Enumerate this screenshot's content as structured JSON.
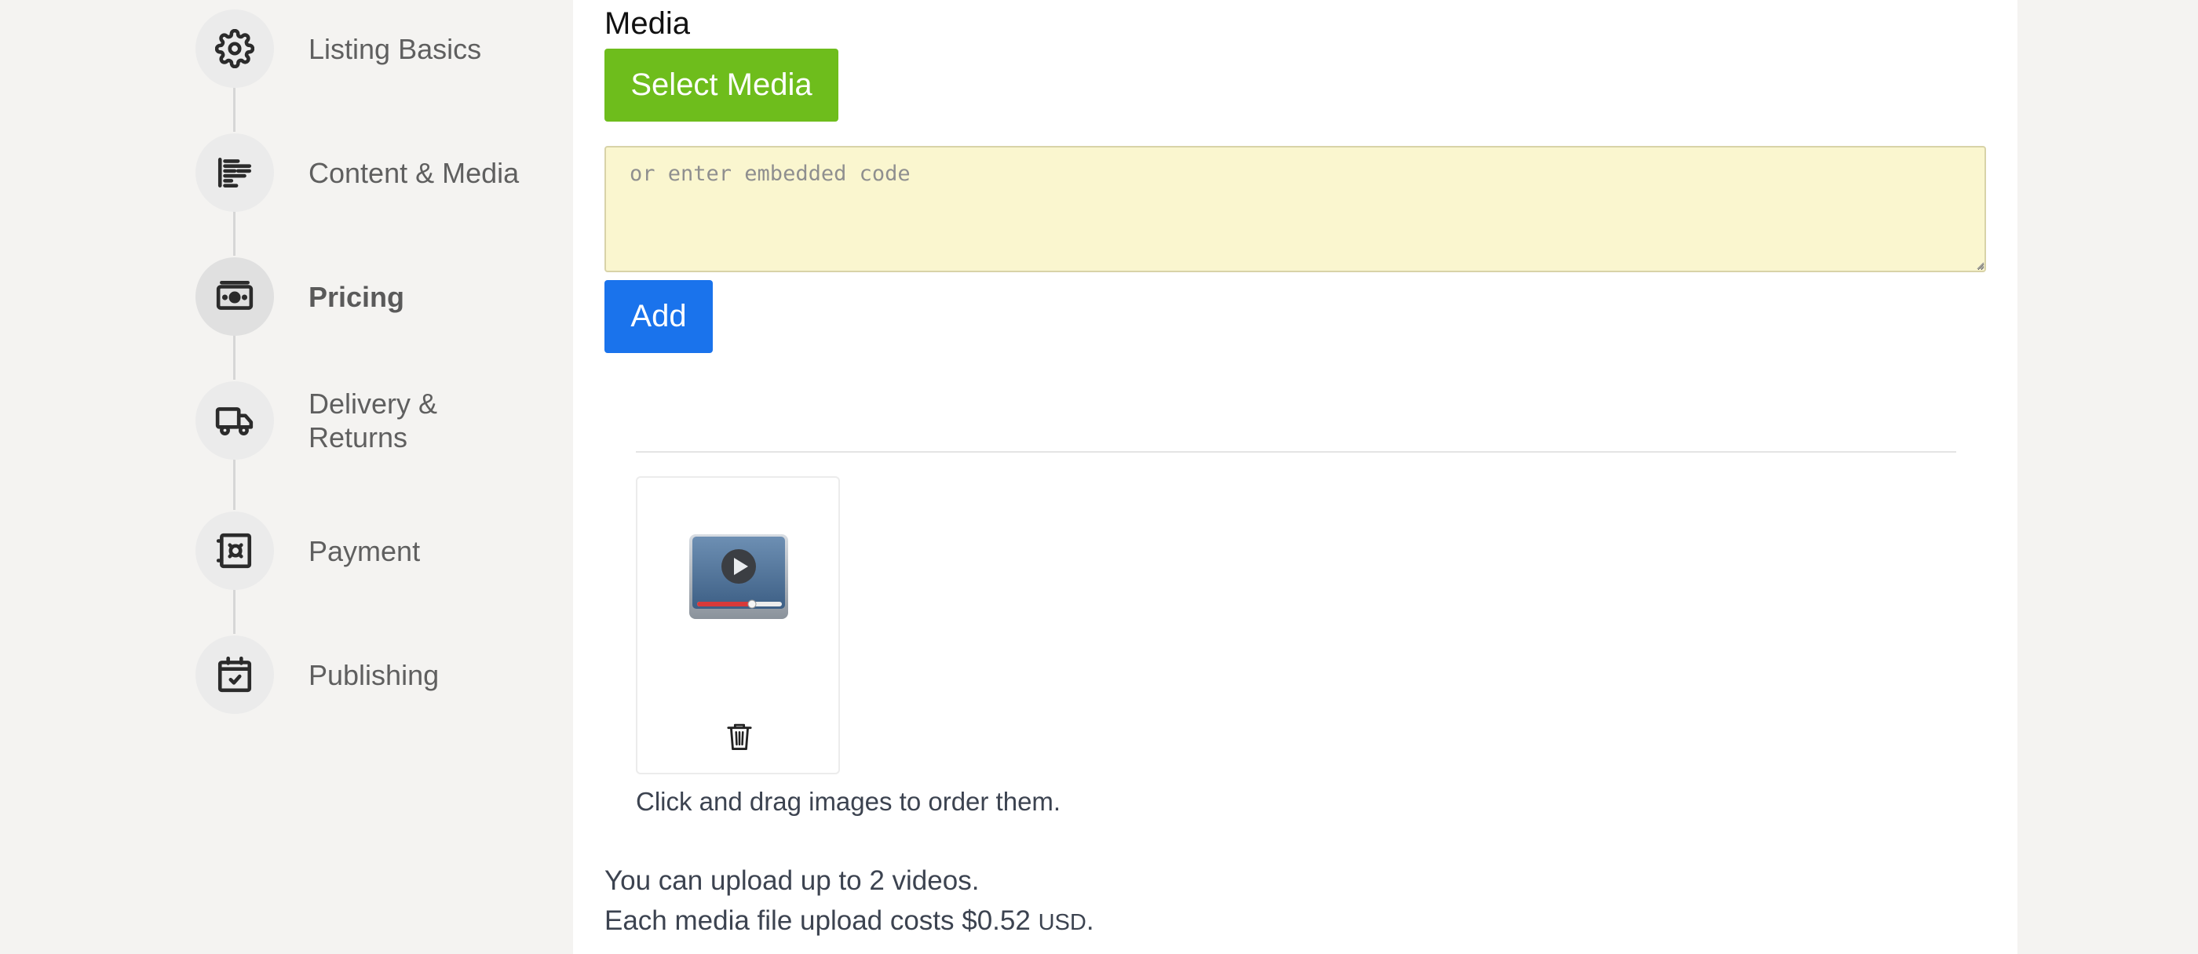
{
  "sidebar": {
    "steps": [
      {
        "label": "Listing Basics",
        "icon": "gear-icon",
        "active": false
      },
      {
        "label": "Content & Media",
        "icon": "text-lines-icon",
        "active": false
      },
      {
        "label": "Pricing",
        "icon": "banknote-icon",
        "active": true
      },
      {
        "label": "Delivery & Returns",
        "icon": "truck-icon",
        "active": false
      },
      {
        "label": "Payment",
        "icon": "safe-icon",
        "active": false
      },
      {
        "label": "Publishing",
        "icon": "calendar-check-icon",
        "active": false
      }
    ]
  },
  "media": {
    "title": "Media",
    "select_button": "Select Media",
    "embed_placeholder": "or enter embedded code",
    "add_button": "Add",
    "items": [
      {
        "type": "video",
        "icon": "video-player-icon"
      }
    ],
    "drag_hint": "Click and drag images to order them.",
    "upload_limit": "You can upload up to 2 videos.",
    "cost_prefix": "Each media file upload costs $0.52",
    "cost_currency": "USD",
    "cost_suffix": "."
  },
  "colors": {
    "select_button": "#6ebd1c",
    "add_button": "#1a73ec",
    "embed_background": "#faf6cf"
  }
}
